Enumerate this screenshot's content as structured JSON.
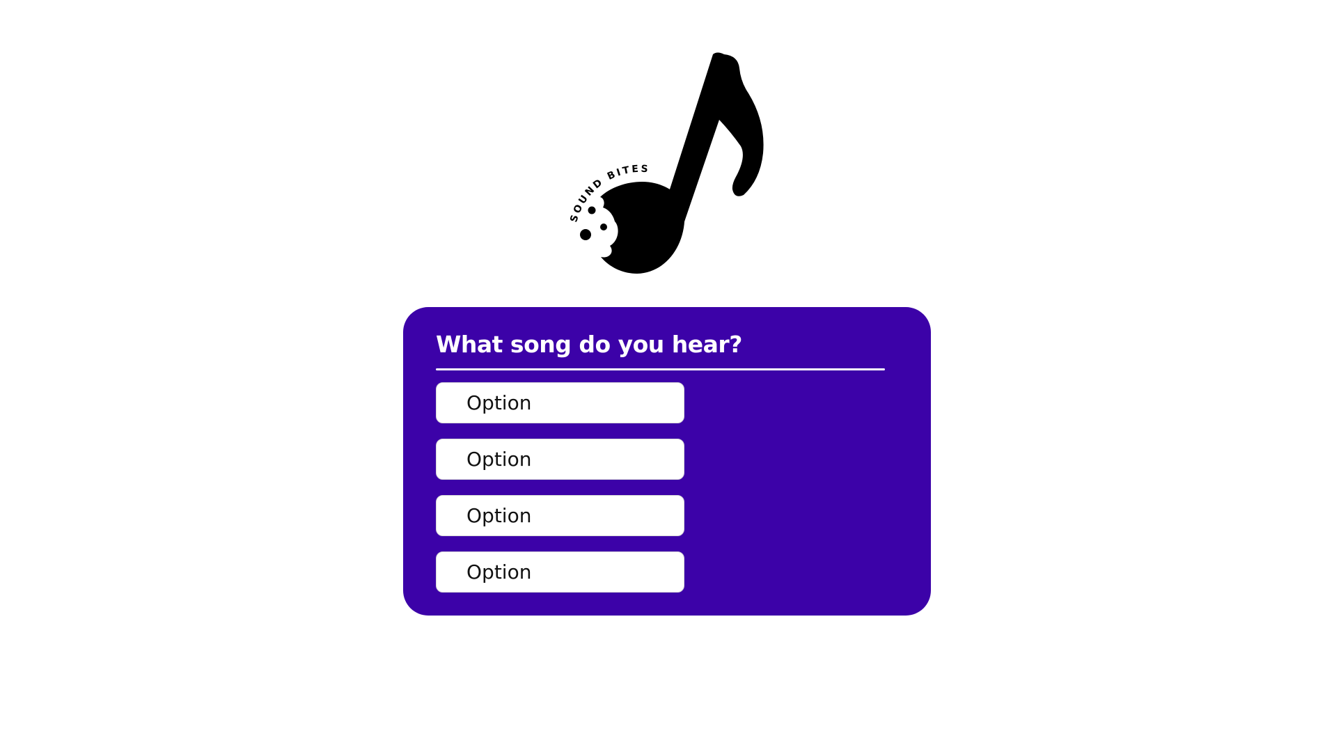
{
  "logo": {
    "text": "SOUND BITES",
    "icon": "music-note-icon"
  },
  "quiz": {
    "question": "What song do you hear?",
    "options": [
      {
        "label": "Option"
      },
      {
        "label": "Option"
      },
      {
        "label": "Option"
      },
      {
        "label": "Option"
      }
    ]
  },
  "colors": {
    "card_background": "#3c02a8",
    "option_background": "#ffffff",
    "logo": "#000000"
  }
}
